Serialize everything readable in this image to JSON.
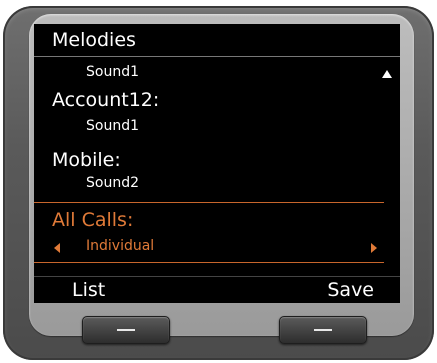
{
  "screen": {
    "title": "Melodies",
    "items": [
      {
        "label": "",
        "value": "Sound1"
      },
      {
        "label": "Account12:",
        "value": "Sound1"
      },
      {
        "label": "Mobile:",
        "value": "Sound2"
      },
      {
        "label": "All Calls:",
        "value": "Individual"
      }
    ]
  },
  "softkeys": {
    "left": "List",
    "right": "Save"
  },
  "colors": {
    "highlight": "#e07a38",
    "screen_bg": "#000000",
    "text": "#ffffff"
  },
  "icons": {
    "scroll_up": "triangle-up-icon",
    "prev_option": "triangle-left-icon",
    "next_option": "triangle-right-icon"
  }
}
